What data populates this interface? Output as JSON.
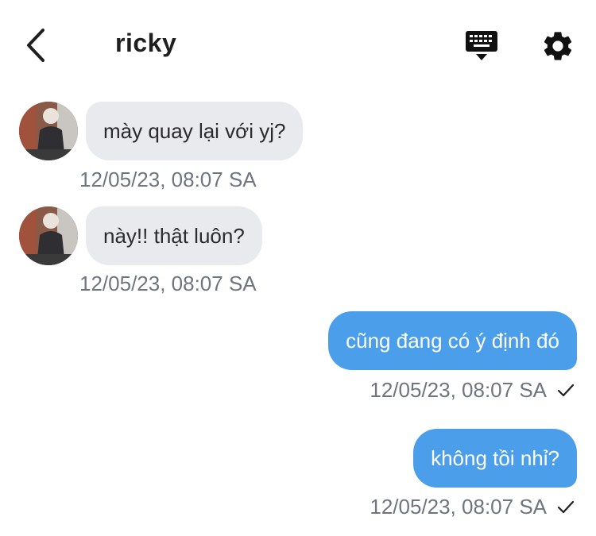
{
  "header": {
    "title": "ricky",
    "icons": [
      "chevron-left-icon",
      "keyboard-icon",
      "gear-icon"
    ]
  },
  "messages": [
    {
      "direction": "incoming",
      "text": "mày quay lại với yj?",
      "timestamp": "12/05/23, 08:07 SA"
    },
    {
      "direction": "incoming",
      "text": "này!! thật luôn?",
      "timestamp": "12/05/23, 08:07 SA"
    },
    {
      "direction": "outgoing",
      "text": "cũng đang có ý định đó",
      "timestamp": "12/05/23, 08:07 SA",
      "status": "sent"
    },
    {
      "direction": "outgoing",
      "text": "không tồi nhỉ?",
      "timestamp": "12/05/23, 08:07 SA",
      "status": "sent"
    }
  ],
  "colors": {
    "outgoing_bubble": "#4a9eea",
    "incoming_bubble": "#e8eaee",
    "timestamp": "#6f7580"
  }
}
